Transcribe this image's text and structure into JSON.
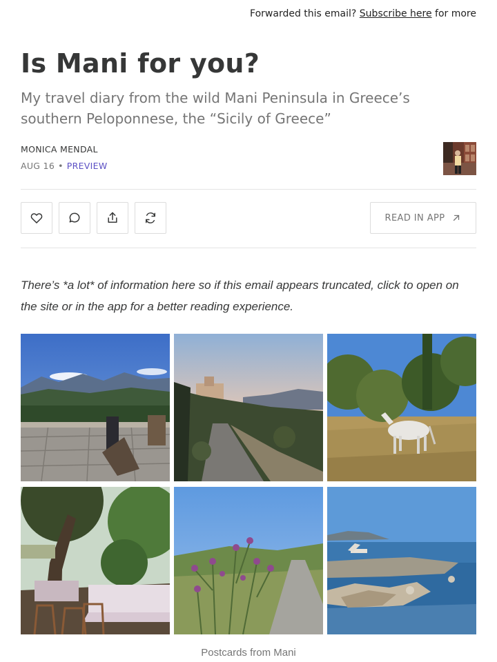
{
  "header": {
    "forward_prefix": "Forwarded this email?",
    "subscribe_link": "Subscribe here",
    "forward_suffix": "for more"
  },
  "post": {
    "title": "Is Mani for you?",
    "subtitle": "My travel diary from the wild Mani Peninsula in Greece’s southern Peloponnese, the “Sicily of Greece”",
    "author": "MONICA MENDAL",
    "date": "AUG 16",
    "separator": "•",
    "preview_label": "PREVIEW"
  },
  "actions": {
    "icons": [
      "heart-icon",
      "comment-icon",
      "share-icon",
      "restack-icon"
    ],
    "read_in_app_label": "READ IN APP",
    "read_in_app_icon": "arrow-up-right-icon"
  },
  "body": {
    "notice": "There’s *a lot* of information here so if this email appears truncated, click to open on the site or in the app for a better reading experience."
  },
  "gallery": {
    "caption": "Postcards from Mani",
    "photos": [
      "mountain-terrace-photo",
      "sunset-road-photo",
      "white-horse-photo",
      "tree-restaurant-photo",
      "thistle-road-photo",
      "sea-coast-photo"
    ]
  },
  "colors": {
    "text": "#363737",
    "muted": "#757575",
    "accent": "#5b4fc4",
    "border": "#dcdcdc"
  }
}
